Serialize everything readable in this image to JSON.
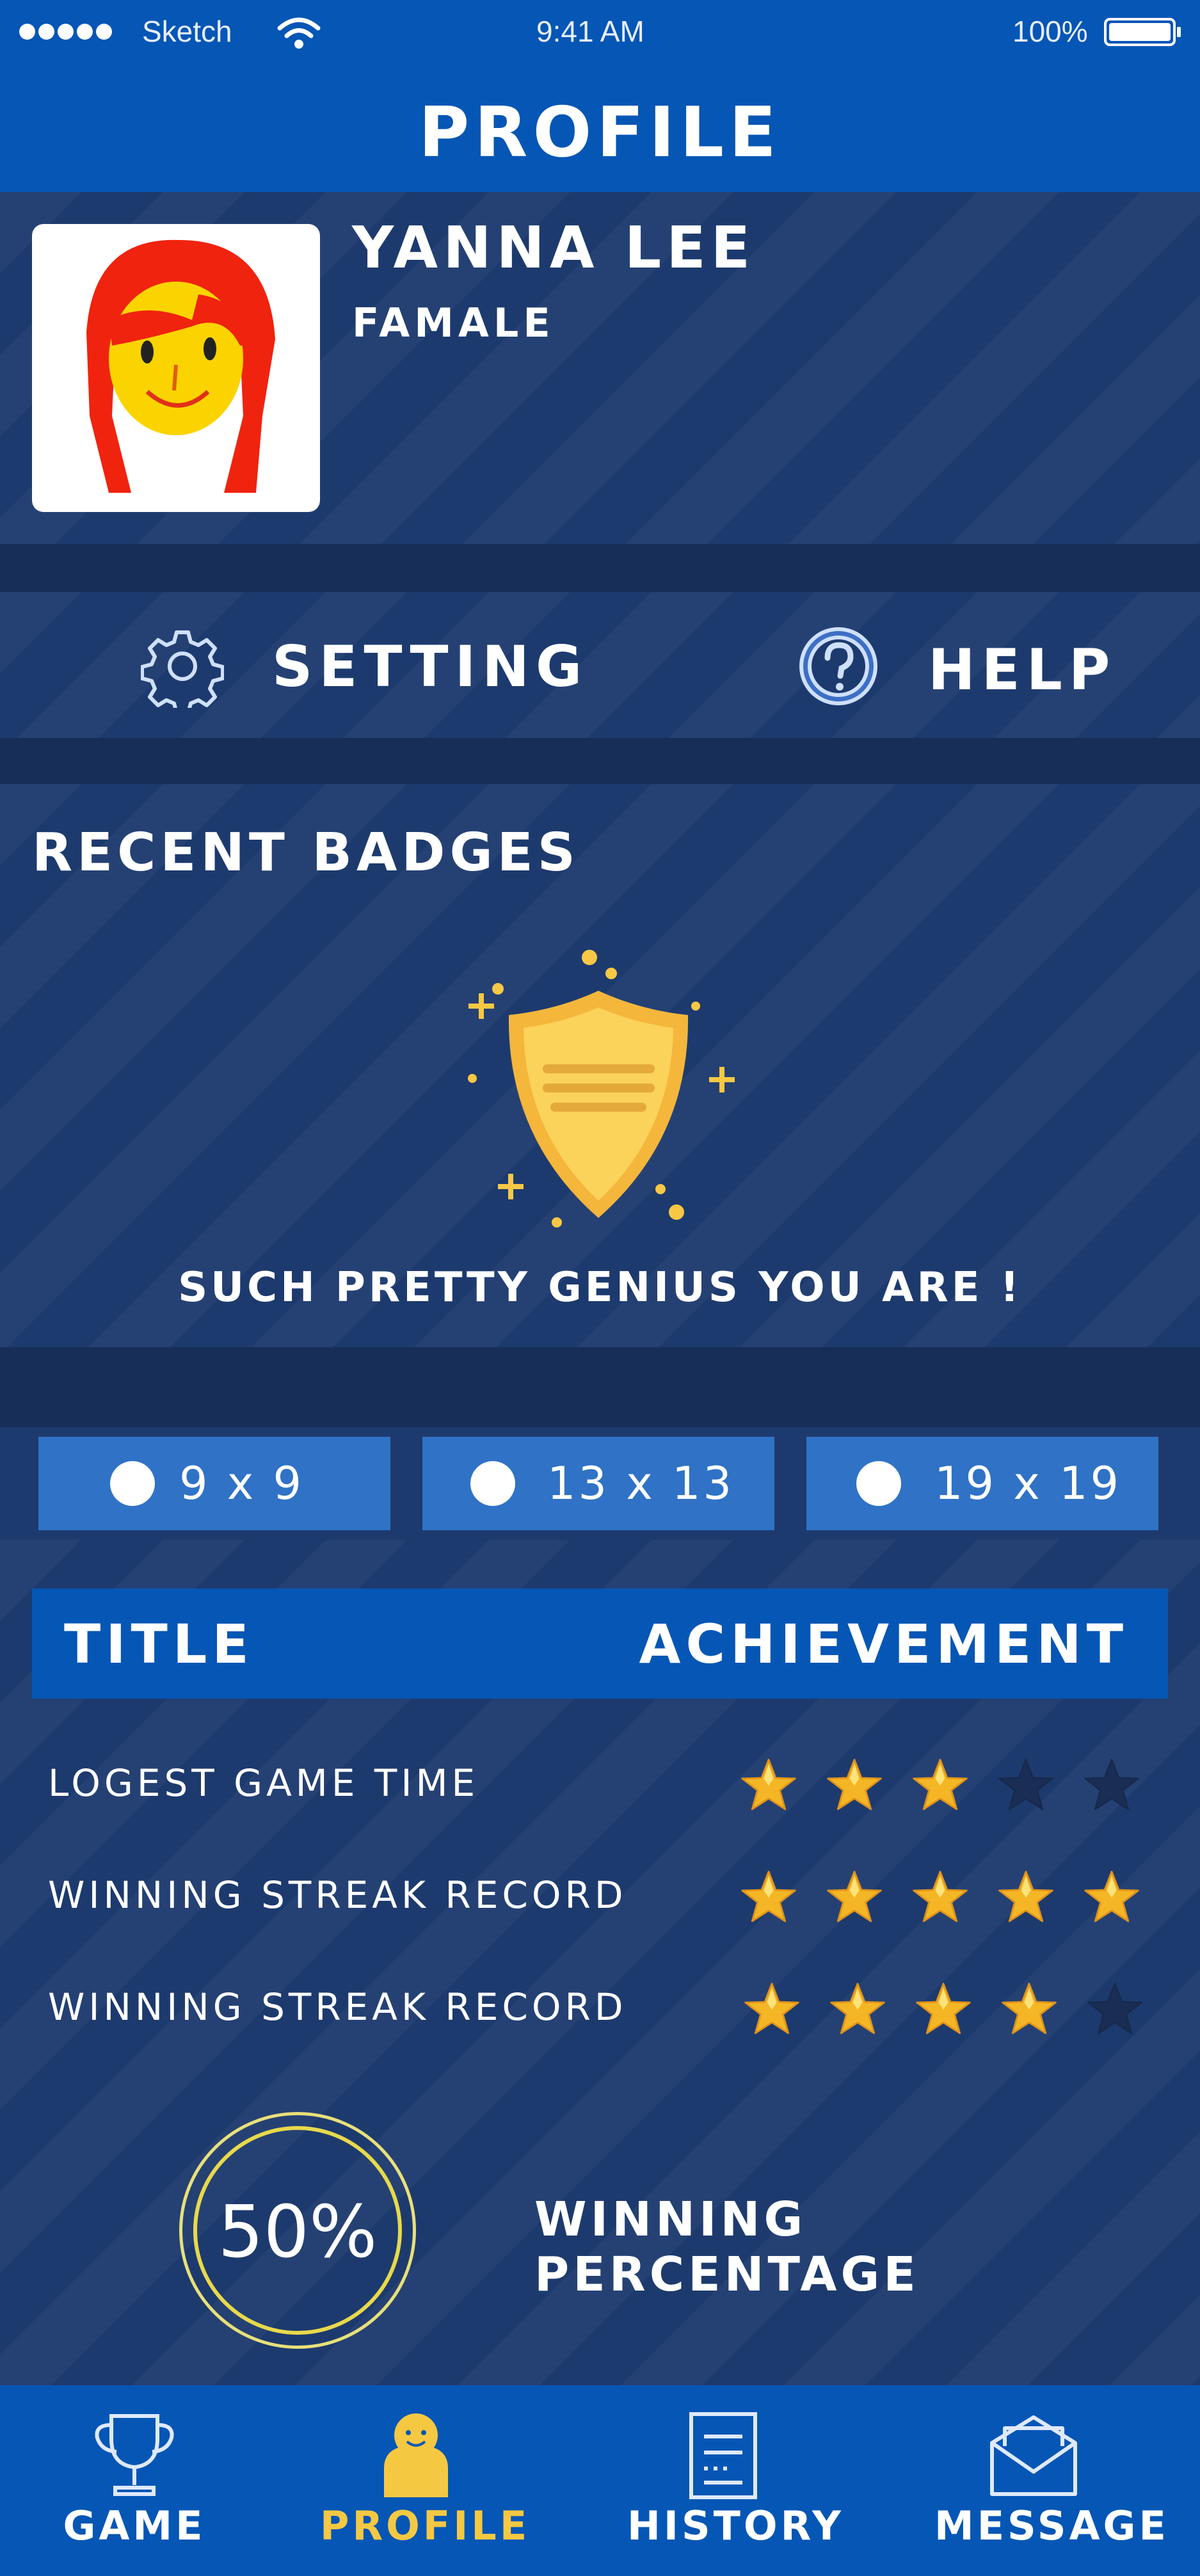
{
  "status_bar": {
    "carrier": "Sketch",
    "time": "9:41 AM",
    "battery": "100%"
  },
  "header": {
    "title": "PROFILE"
  },
  "profile": {
    "name": "YANNA LEE",
    "gender": "FAMALE"
  },
  "actions": {
    "setting_label": "SETTING",
    "help_label": "HELP"
  },
  "badges": {
    "heading": "RECENT BADGES",
    "caption": "SUCH PRETTY GENIUS YOU ARE !"
  },
  "board_sizes": [
    {
      "label": "9 x 9"
    },
    {
      "label": "13 x 13"
    },
    {
      "label": "19 x 19"
    }
  ],
  "achievements": {
    "col_title": "TITLE",
    "col_achievement": "ACHIEVEMENT",
    "rows": [
      {
        "title": "LOGEST GAME TIME",
        "stars": 3,
        "max": 5
      },
      {
        "title": "WINNING STREAK RECORD",
        "stars": 5,
        "max": 5
      },
      {
        "title": "WINNING STREAK RECORD",
        "stars": 4,
        "max": 5
      }
    ]
  },
  "winning": {
    "percent": "50%",
    "label": "WINNING PERCENTAGE"
  },
  "bottom_nav": [
    {
      "label": "GAME",
      "icon": "trophy-icon",
      "active": false
    },
    {
      "label": "PROFILE",
      "icon": "profile-icon",
      "active": true
    },
    {
      "label": "HISTORY",
      "icon": "document-icon",
      "active": false
    },
    {
      "label": "MESSAGE",
      "icon": "mail-icon",
      "active": false
    }
  ],
  "colors": {
    "brand_blue": "#0556b5",
    "panel": "#1d3a6e",
    "star_gold": "#f5b625",
    "active_nav": "#f5c842",
    "badge_yellow": "#f7c844"
  }
}
